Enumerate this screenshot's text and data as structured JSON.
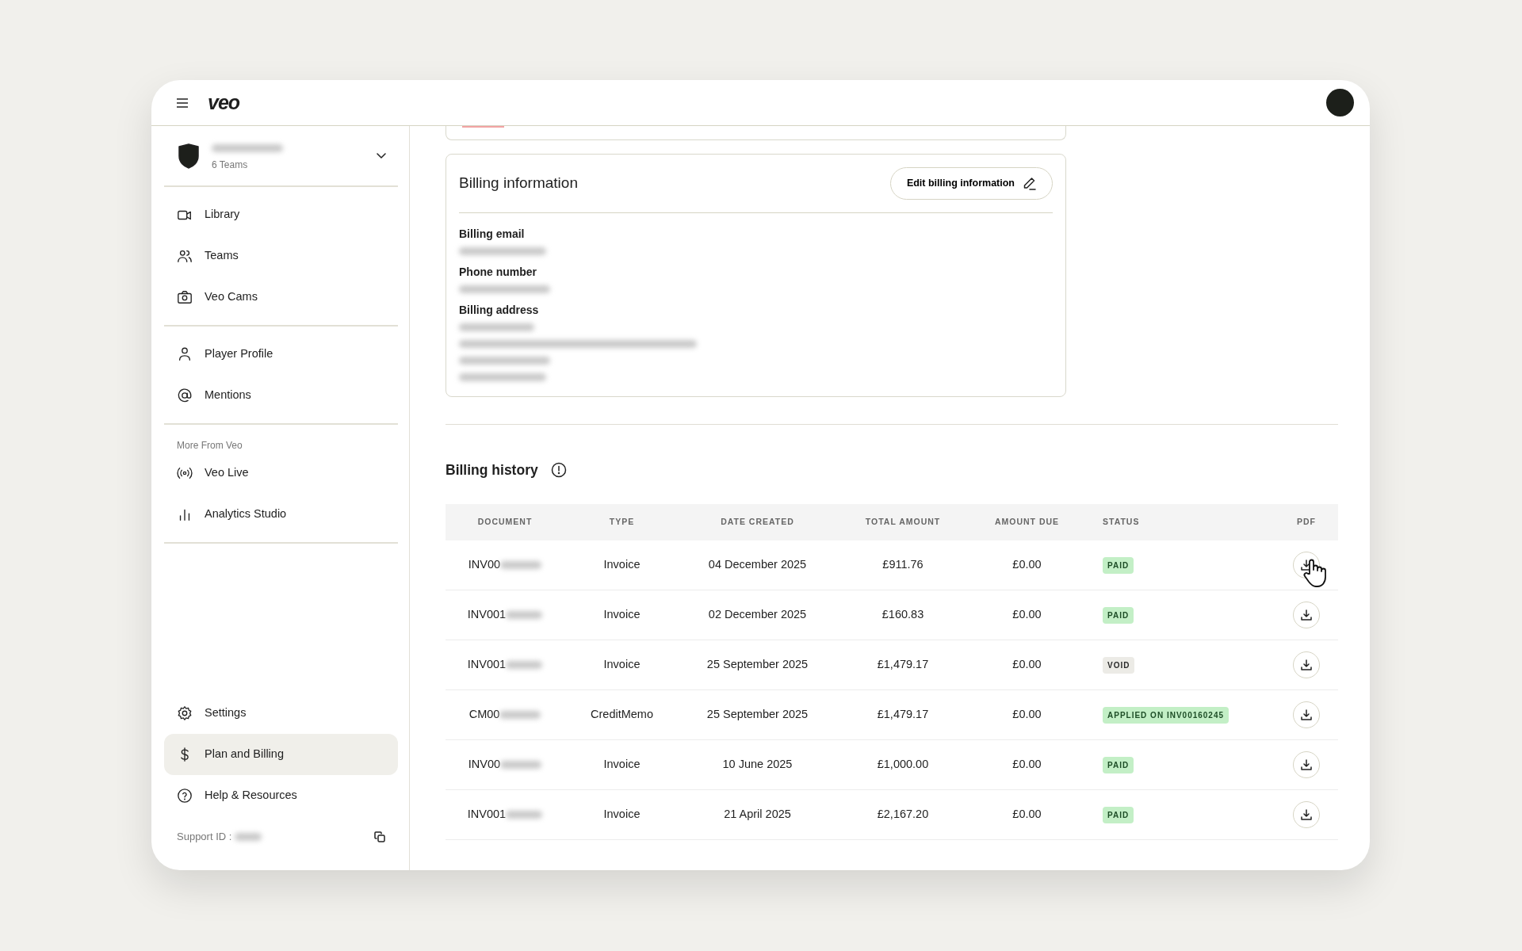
{
  "header": {
    "logo": "veo"
  },
  "organization": {
    "subtitle": "6 Teams"
  },
  "sidebar": {
    "sections": [
      {
        "items": [
          {
            "label": "Library",
            "selected": false
          },
          {
            "label": "Teams",
            "selected": false
          },
          {
            "label": "Veo Cams",
            "selected": false
          }
        ]
      },
      {
        "items": [
          {
            "label": "Player Profile",
            "selected": false
          },
          {
            "label": "Mentions",
            "selected": false
          }
        ]
      },
      {
        "heading": "More From Veo",
        "items": [
          {
            "label": "Veo Live",
            "selected": false
          },
          {
            "label": "Analytics Studio",
            "selected": false
          }
        ]
      }
    ],
    "bottom_items": [
      {
        "label": "Settings",
        "selected": false
      },
      {
        "label": "Plan and Billing",
        "selected": true
      },
      {
        "label": "Help & Resources",
        "selected": false
      }
    ],
    "support_label": "Support ID :"
  },
  "billing_information": {
    "title": "Billing information",
    "edit_button": "Edit billing information",
    "fields": [
      {
        "label": "Billing email"
      },
      {
        "label": "Phone number"
      },
      {
        "label": "Billing address"
      }
    ]
  },
  "billing_history": {
    "title": "Billing history",
    "columns": [
      "DOCUMENT",
      "TYPE",
      "DATE CREATED",
      "TOTAL AMOUNT",
      "AMOUNT DUE",
      "STATUS",
      "PDF"
    ],
    "rows": [
      {
        "document": "INV00",
        "type": "Invoice",
        "date": "04 December 2025",
        "total": "£911.76",
        "due": "£0.00",
        "status": "PAID",
        "color": "#c3efc6"
      },
      {
        "document": "INV001",
        "type": "Invoice",
        "date": "02 December 2025",
        "total": "£160.83",
        "due": "£0.00",
        "status": "PAID",
        "color": "#c3efc6"
      },
      {
        "document": "INV001",
        "type": "Invoice",
        "date": "25 September 2025",
        "total": "£1,479.17",
        "due": "£0.00",
        "status": "VOID",
        "color": "#ecebe6"
      },
      {
        "document": "CM00",
        "type": "CreditMemo",
        "date": "25 September 2025",
        "total": "£1,479.17",
        "due": "£0.00",
        "status": "APPLIED ON INV00160245",
        "color": "#c3efc6"
      },
      {
        "document": "INV00",
        "type": "Invoice",
        "date": "10 June 2025",
        "total": "£1,000.00",
        "due": "£0.00",
        "status": "PAID",
        "color": "#c3efc6"
      },
      {
        "document": "INV001",
        "type": "Invoice",
        "date": "21 April 2025",
        "total": "£2,167.20",
        "due": "£0.00",
        "status": "PAID",
        "color": "#c3efc6"
      }
    ]
  }
}
